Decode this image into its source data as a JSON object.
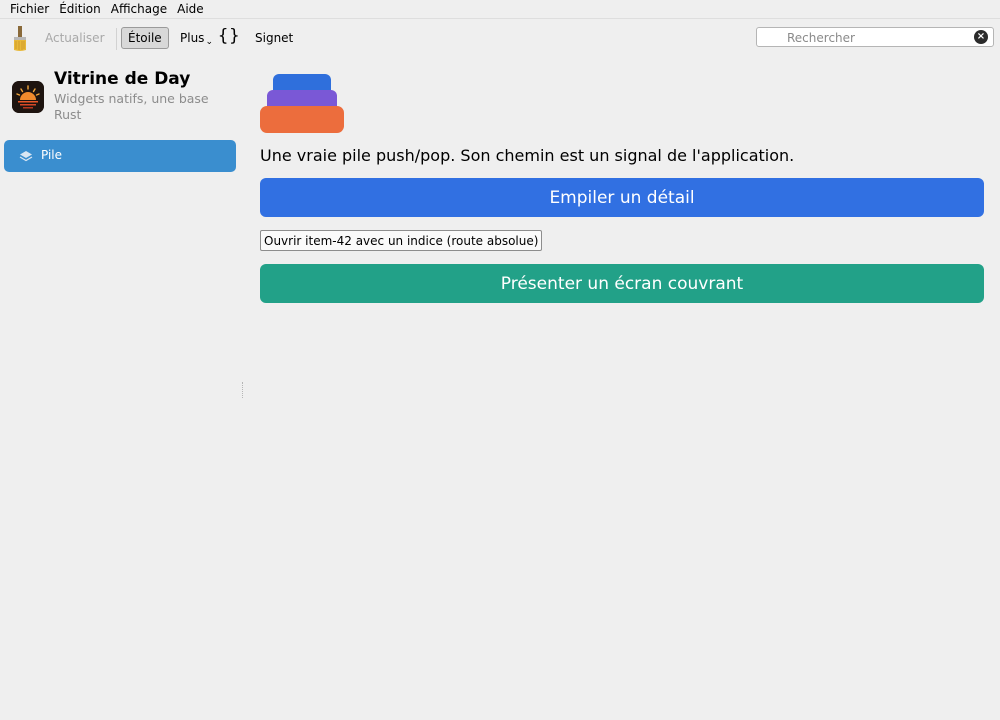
{
  "menubar": {
    "items": [
      "Fichier",
      "Édition",
      "Affichage",
      "Aide"
    ]
  },
  "toolbar": {
    "brush_icon": "brush-icon",
    "refresh_label": "Actualiser",
    "star_label": "Étoile",
    "more_label": "Plus",
    "braces_label": "{}",
    "bookmark_label": "Signet",
    "search_placeholder": "Rechercher",
    "search_value": ""
  },
  "sidebar": {
    "app_title": "Vitrine de Day",
    "app_subtitle": "Widgets natifs, une base Rust",
    "items": [
      {
        "label": "Pile",
        "icon": "layers-icon",
        "selected": true
      }
    ]
  },
  "main": {
    "hero_icon": "stack-icon",
    "description": "Une vraie pile push/pop. Son chemin est un signal de l'application.",
    "push_button": "Empiler un détail",
    "open_button": "Ouvrir item-42 avec un indice (route absolue)",
    "present_button": "Présenter un écran couvrant"
  },
  "colors": {
    "selection": "#3a8ecf",
    "push_button": "#3170e2",
    "present_button": "#22a188",
    "stack_top": "#2f6fdc",
    "stack_middle": "#7a58d6",
    "stack_bottom": "#ec6d3d"
  }
}
